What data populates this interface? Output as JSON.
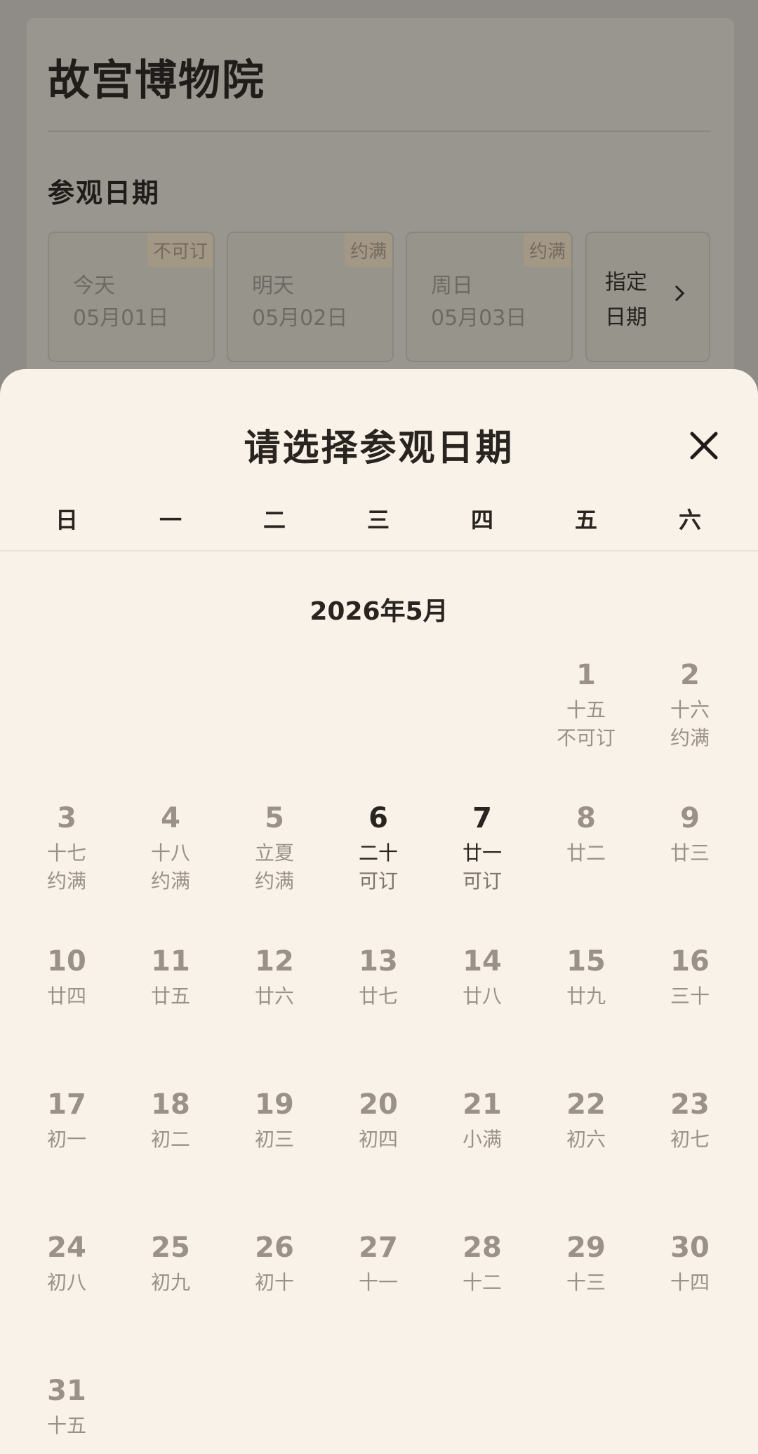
{
  "museum": {
    "title": "故宫博物院",
    "visit_date_label": "参观日期",
    "date_options": [
      {
        "day": "今天",
        "date": "05月01日",
        "tag": "不可订"
      },
      {
        "day": "明天",
        "date": "05月02日",
        "tag": "约满"
      },
      {
        "day": "周日",
        "date": "05月03日",
        "tag": "约满"
      }
    ],
    "specify_label": "指定日期"
  },
  "sheet": {
    "title": "请选择参观日期",
    "weekdays": [
      "日",
      "一",
      "二",
      "三",
      "四",
      "五",
      "六"
    ],
    "month_title": "2026年5月"
  },
  "calendar": {
    "first_weekday_index": 5,
    "days": [
      {
        "day": "1",
        "lunar": "十五",
        "status": "不可订",
        "available": false
      },
      {
        "day": "2",
        "lunar": "十六",
        "status": "约满",
        "available": false
      },
      {
        "day": "3",
        "lunar": "十七",
        "status": "约满",
        "available": false
      },
      {
        "day": "4",
        "lunar": "十八",
        "status": "约满",
        "available": false
      },
      {
        "day": "5",
        "lunar": "立夏",
        "status": "约满",
        "available": false
      },
      {
        "day": "6",
        "lunar": "二十",
        "status": "可订",
        "available": true
      },
      {
        "day": "7",
        "lunar": "廿一",
        "status": "可订",
        "available": true
      },
      {
        "day": "8",
        "lunar": "廿二",
        "status": "",
        "available": false
      },
      {
        "day": "9",
        "lunar": "廿三",
        "status": "",
        "available": false
      },
      {
        "day": "10",
        "lunar": "廿四",
        "status": "",
        "available": false
      },
      {
        "day": "11",
        "lunar": "廿五",
        "status": "",
        "available": false
      },
      {
        "day": "12",
        "lunar": "廿六",
        "status": "",
        "available": false
      },
      {
        "day": "13",
        "lunar": "廿七",
        "status": "",
        "available": false
      },
      {
        "day": "14",
        "lunar": "廿八",
        "status": "",
        "available": false
      },
      {
        "day": "15",
        "lunar": "廿九",
        "status": "",
        "available": false
      },
      {
        "day": "16",
        "lunar": "三十",
        "status": "",
        "available": false
      },
      {
        "day": "17",
        "lunar": "初一",
        "status": "",
        "available": false
      },
      {
        "day": "18",
        "lunar": "初二",
        "status": "",
        "available": false
      },
      {
        "day": "19",
        "lunar": "初三",
        "status": "",
        "available": false
      },
      {
        "day": "20",
        "lunar": "初四",
        "status": "",
        "available": false
      },
      {
        "day": "21",
        "lunar": "小满",
        "status": "",
        "available": false
      },
      {
        "day": "22",
        "lunar": "初六",
        "status": "",
        "available": false
      },
      {
        "day": "23",
        "lunar": "初七",
        "status": "",
        "available": false
      },
      {
        "day": "24",
        "lunar": "初八",
        "status": "",
        "available": false
      },
      {
        "day": "25",
        "lunar": "初九",
        "status": "",
        "available": false
      },
      {
        "day": "26",
        "lunar": "初十",
        "status": "",
        "available": false
      },
      {
        "day": "27",
        "lunar": "十一",
        "status": "",
        "available": false
      },
      {
        "day": "28",
        "lunar": "十二",
        "status": "",
        "available": false
      },
      {
        "day": "29",
        "lunar": "十三",
        "status": "",
        "available": false
      },
      {
        "day": "30",
        "lunar": "十四",
        "status": "",
        "available": false
      },
      {
        "day": "31",
        "lunar": "十五",
        "status": "",
        "available": false
      }
    ]
  },
  "icons": {
    "close": "close-icon",
    "chevron": "chevron-right-icon"
  },
  "colors": {
    "sheet_bg": "#f8f2e8",
    "text_dark": "#2a2420",
    "text_muted": "#9a9188"
  }
}
